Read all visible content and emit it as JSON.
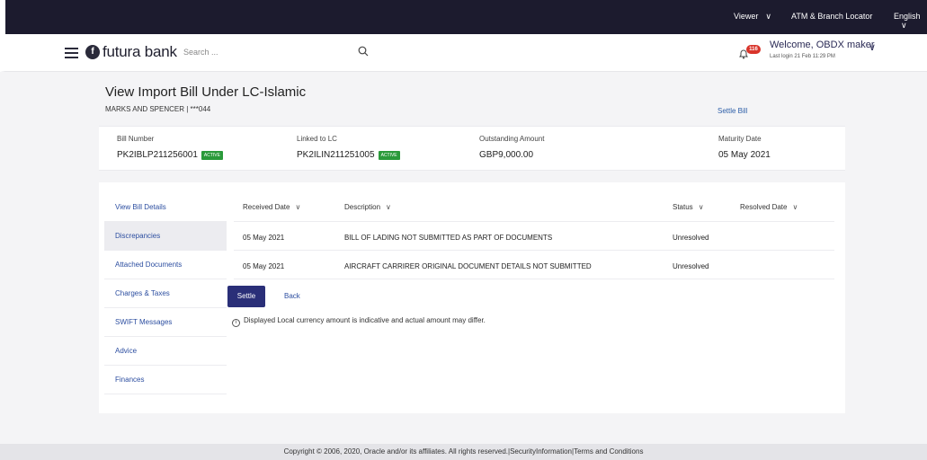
{
  "topbar": {
    "viewer": "Viewer",
    "locator": "ATM & Branch Locator",
    "language": "English"
  },
  "header": {
    "logo_text": "futura bank",
    "search_placeholder": "Search ...",
    "notifications_count": "116",
    "welcome": "Welcome, OBDX maker",
    "last_login": "Last login 21 Feb 11:29 PM"
  },
  "page": {
    "title": "View Import Bill Under LC-Islamic",
    "subtitle": "MARKS AND SPENCER | ***044",
    "settle_link": "Settle Bill"
  },
  "summary": {
    "bill_number_label": "Bill Number",
    "bill_number": "PK2IBLP211256001",
    "bill_status": "ACTIVE",
    "linked_lc_label": "Linked to LC",
    "linked_lc": "PK2ILIN211251005",
    "lc_status": "ACTIVE",
    "outstanding_label": "Outstanding Amount",
    "outstanding": "GBP9,000.00",
    "maturity_label": "Maturity Date",
    "maturity": "05 May 2021"
  },
  "sidebar": {
    "items": [
      {
        "label": "View Bill Details"
      },
      {
        "label": "Discrepancies"
      },
      {
        "label": "Attached Documents"
      },
      {
        "label": "Charges & Taxes"
      },
      {
        "label": "SWIFT Messages"
      },
      {
        "label": "Advice"
      },
      {
        "label": "Finances"
      }
    ]
  },
  "table": {
    "headers": {
      "received": "Received Date",
      "description": "Description",
      "status": "Status",
      "resolved": "Resolved Date"
    },
    "rows": [
      {
        "received": "05 May 2021",
        "description": "BILL OF LADING NOT SUBMITTED AS PART OF DOCUMENTS",
        "status": "Unresolved",
        "resolved": ""
      },
      {
        "received": "05 May 2021",
        "description": "AIRCRAFT CARRIRER ORIGINAL DOCUMENT DETAILS NOT SUBMITTED",
        "status": "Unresolved",
        "resolved": ""
      }
    ]
  },
  "actions": {
    "settle": "Settle",
    "back": "Back"
  },
  "note": "Displayed Local currency amount is indicative and actual amount may differ.",
  "footer": "Copyright © 2006, 2020, Oracle and/or its affiliates. All rights reserved.|SecurityInformation|Terms and Conditions",
  "colors": {
    "topbar": "#1c1b2e",
    "primary_button": "#2a2f78",
    "active_badge": "#2a9a3a",
    "notification": "#d9342b"
  }
}
